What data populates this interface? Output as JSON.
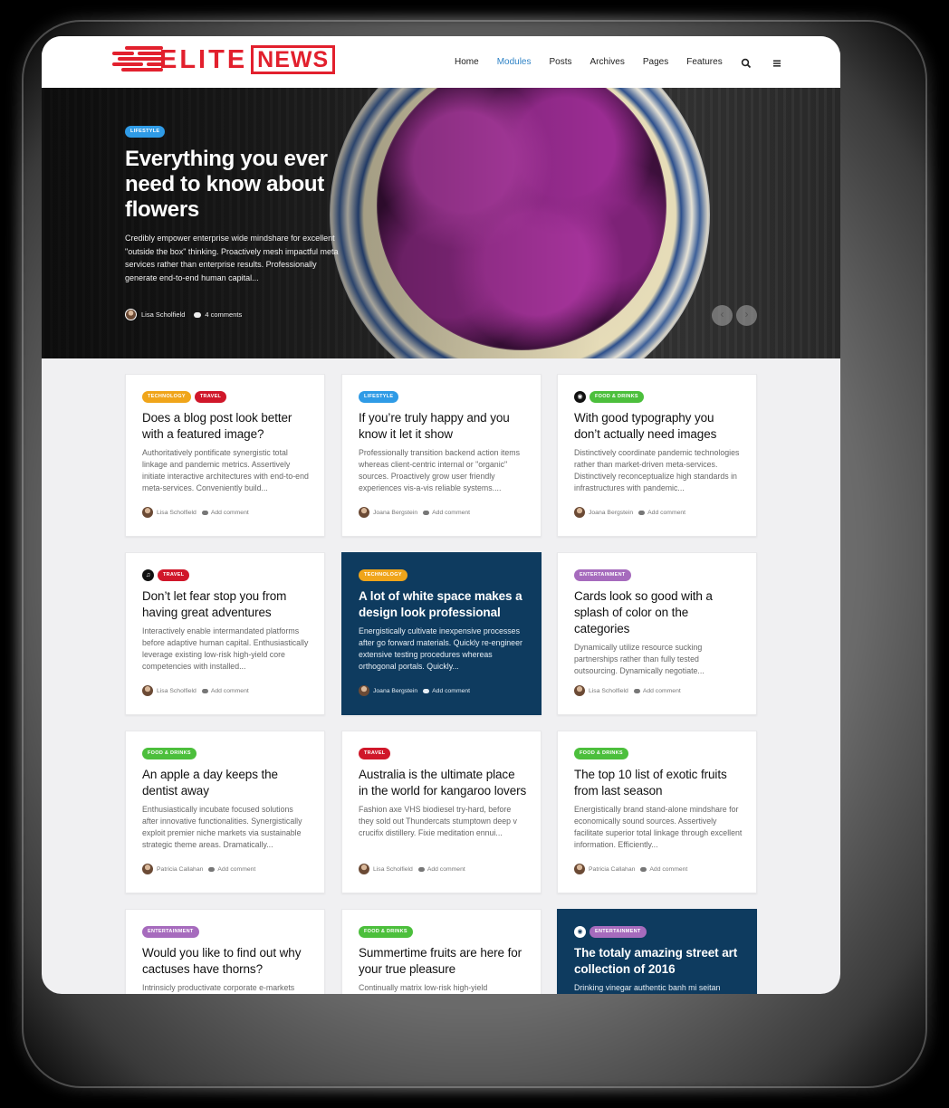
{
  "logo": {
    "elite": "ELITE",
    "news": "NEWS"
  },
  "nav": {
    "items": [
      "Home",
      "Modules",
      "Posts",
      "Archives",
      "Pages",
      "Features"
    ],
    "active": "Modules"
  },
  "icons": {
    "search": "search-icon",
    "menu": "hamburger-icon",
    "comments": "comment-icon",
    "camera": "camera-icon",
    "music": "music-icon"
  },
  "colors": {
    "brand": "#e2202d",
    "nav_active": "#2f83c6",
    "lifestyle": "#2f9be6",
    "technology": "#f0a51a",
    "travel": "#d0172a",
    "food": "#4cbf3c",
    "entertainment": "#a66bbd",
    "dark_card": "#0e3b5f"
  },
  "hero": {
    "category": "LIFESTYLE",
    "title": "Everything you ever need to know about flowers",
    "excerpt": "Credibly empower enterprise wide mindshare for excellent \"outside the box\" thinking. Proactively mesh impactful meta services rather than enterprise results. Professionally generate end-to-end human capital...",
    "author": "Lisa Scholfield",
    "comments": "4 comments",
    "prev": "‹",
    "next": "›"
  },
  "cards": [
    {
      "title": "Does a blog post look better with a featured image?",
      "excerpt": "Authoritatively pontificate synergistic total linkage and pandemic metrics. Assertively initiate interactive architectures with end-to-end meta-services. Conveniently build...",
      "author": "Lisa Scholfield",
      "comments": "Add comment",
      "badges": [
        "TECHNOLOGY",
        "TRAVEL"
      ]
    },
    {
      "title": "If you’re truly happy and you know it let it show",
      "excerpt": "Professionally transition backend action items whereas client-centric internal or \"organic\" sources. Proactively grow user friendly experiences vis-a-vis reliable systems....",
      "author": "Joana Bergstein",
      "comments": "Add comment",
      "badges": [
        "LIFESTYLE"
      ]
    },
    {
      "title": "With good typography you don’t actually need images",
      "excerpt": "Distinctively coordinate pandemic technologies rather than market-driven meta-services. Distinctively reconceptualize high standards in infrastructures with pandemic...",
      "author": "Joana Bergstein",
      "comments": "Add comment",
      "badges": [
        "FOOD & DRINKS"
      ]
    },
    {
      "title": "Don’t let fear stop you from having great adventures",
      "excerpt": "Interactively enable intermandated platforms before adaptive human capital. Enthusiastically leverage existing low-risk high-yield core competencies with installed...",
      "author": "Lisa Scholfield",
      "comments": "Add comment",
      "badges": [
        "TRAVEL"
      ]
    },
    {
      "title": "A lot of white space makes a design look professional",
      "excerpt": "Energistically cultivate inexpensive processes after go forward materials. Quickly re-engineer extensive testing procedures whereas orthogonal portals. Quickly...",
      "author": "Joana Bergstein",
      "comments": "Add comment",
      "badges": [
        "TECHNOLOGY"
      ]
    },
    {
      "title": "Cards look so good with a splash of color on the categories",
      "excerpt": "Dynamically utilize resource sucking partnerships rather than fully tested outsourcing. Dynamically negotiate...",
      "author": "Lisa Scholfield",
      "comments": "Add comment",
      "badges": [
        "ENTERTAINMENT"
      ]
    },
    {
      "title": "An apple a day keeps the dentist away",
      "excerpt": "Enthusiastically incubate focused solutions after innovative functionalities. Synergistically exploit premier niche markets via sustainable strategic theme areas. Dramatically...",
      "author": "Patricia Callahan",
      "comments": "Add comment",
      "badges": [
        "FOOD & DRINKS"
      ]
    },
    {
      "title": "Australia is the ultimate place in the world for kangaroo lovers",
      "excerpt": "Fashion axe VHS biodiesel try-hard, before they sold out Thundercats stumptown deep v crucifix distillery. Fixie meditation ennui...",
      "author": "Lisa Scholfield",
      "comments": "Add comment",
      "badges": [
        "TRAVEL"
      ]
    },
    {
      "title": "The top 10 list of exotic fruits from last season",
      "excerpt": "Energistically brand stand-alone mindshare for economically sound sources. Assertively facilitate superior total linkage through excellent information. Efficiently...",
      "author": "Patricia Callahan",
      "comments": "Add comment",
      "badges": [
        "FOOD & DRINKS"
      ]
    },
    {
      "title": "Would you like to find out why cactuses have thorns?",
      "excerpt": "Intrinsicly productivate corporate e-markets",
      "author": "",
      "comments": "",
      "badges": [
        "ENTERTAINMENT"
      ]
    },
    {
      "title": "Summertime fruits are here for your true pleasure",
      "excerpt": "Continually matrix low-risk high-yield",
      "author": "",
      "comments": "",
      "badges": [
        "FOOD & DRINKS"
      ]
    },
    {
      "title": "The totaly amazing street art collection of 2016",
      "excerpt": "Drinking vinegar authentic banh mi seitan",
      "author": "",
      "comments": "",
      "badges": [
        "ENTERTAINMENT"
      ]
    }
  ]
}
